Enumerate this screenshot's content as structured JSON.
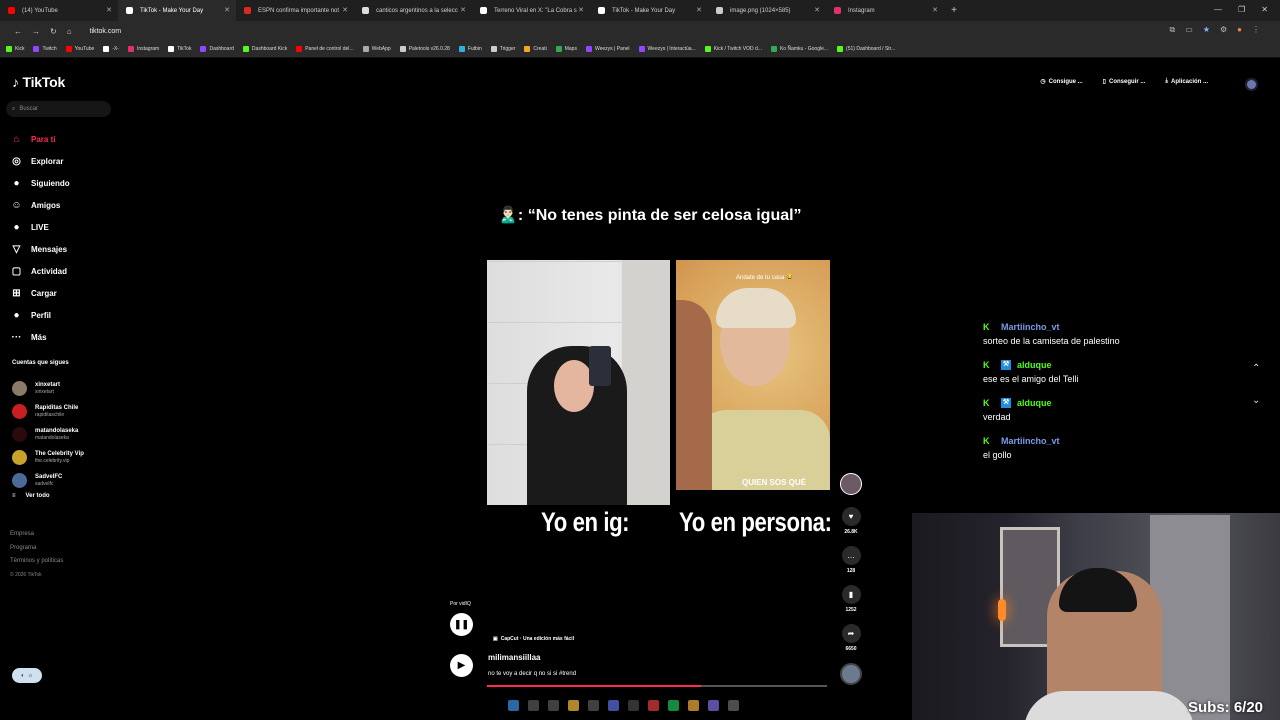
{
  "browser": {
    "tabs": [
      {
        "title": "(14) YouTube",
        "color": "#ff0000",
        "active": false
      },
      {
        "title": "TikTok - Make Your Day",
        "color": "#ffffff",
        "active": true
      },
      {
        "title": "ESPN confirma importante not",
        "color": "#e0281e",
        "active": false
      },
      {
        "title": "canticos argentinos a la selecc",
        "color": "#dddddd",
        "active": false
      },
      {
        "title": "Terreno Viral en X: \"La Cobra s",
        "color": "#ffffff",
        "active": false
      },
      {
        "title": "TikTok - Make Your Day",
        "color": "#ffffff",
        "active": false
      },
      {
        "title": "image.png (1024×585)",
        "color": "#cccccc",
        "active": false
      },
      {
        "title": "Instagram",
        "color": "#e1306c",
        "active": false
      }
    ],
    "new_tab": "+",
    "url": "tiktok.com",
    "bookmarks": [
      {
        "label": "Kick",
        "color": "#53fc18"
      },
      {
        "label": "Twitch",
        "color": "#9146ff"
      },
      {
        "label": "YouTube",
        "color": "#ff0000"
      },
      {
        "label": "-X-",
        "color": "#ffffff"
      },
      {
        "label": "Instagram",
        "color": "#e1306c"
      },
      {
        "label": "TikTok",
        "color": "#ffffff"
      },
      {
        "label": "Dashboard",
        "color": "#9146ff"
      },
      {
        "label": "Dashboard Kick",
        "color": "#53fc18"
      },
      {
        "label": "Panel de control del...",
        "color": "#ff0000"
      },
      {
        "label": "WebApp",
        "color": "#aaaaaa"
      },
      {
        "label": "Paletools v26.0.28",
        "color": "#cccccc"
      },
      {
        "label": "Futbin",
        "color": "#2fb1e0"
      },
      {
        "label": "Trigger",
        "color": "#cccccc"
      },
      {
        "label": "Creati",
        "color": "#f5a623"
      },
      {
        "label": "Maps",
        "color": "#34a853"
      },
      {
        "label": "Weezys | Panel",
        "color": "#9146ff"
      },
      {
        "label": "Weezys | Interactúa...",
        "color": "#9146ff"
      },
      {
        "label": "Kick / Twitch VOD d...",
        "color": "#53fc18"
      },
      {
        "label": "Ko Ñamku - Google...",
        "color": "#34a853"
      },
      {
        "label": "(51) Dashboard / Str...",
        "color": "#53fc18"
      }
    ]
  },
  "tiktok": {
    "logo": "TikTok",
    "search_placeholder": "Buscar",
    "menu": [
      {
        "label": "Para ti",
        "icon": "home-icon",
        "glyph": "⌂"
      },
      {
        "label": "Explorar",
        "icon": "compass-icon",
        "glyph": "◎"
      },
      {
        "label": "Siguiendo",
        "icon": "following-icon",
        "glyph": "●"
      },
      {
        "label": "Amigos",
        "icon": "friends-icon",
        "glyph": "☺"
      },
      {
        "label": "LIVE",
        "icon": "live-icon",
        "glyph": "●"
      },
      {
        "label": "Mensajes",
        "icon": "messages-icon",
        "glyph": "▽"
      },
      {
        "label": "Actividad",
        "icon": "activity-icon",
        "glyph": "▢"
      },
      {
        "label": "Cargar",
        "icon": "upload-icon",
        "glyph": "⊞"
      },
      {
        "label": "Perfil",
        "icon": "profile-icon",
        "glyph": "●"
      },
      {
        "label": "Más",
        "icon": "more-icon",
        "glyph": "···"
      }
    ],
    "following_title": "Cuentas que sigues",
    "following": [
      {
        "name": "xinxetart",
        "handle": "xinxetart",
        "color": "#8a7a6a"
      },
      {
        "name": "Rapiditas Chile",
        "handle": "rapiditaschile",
        "color": "#c82020"
      },
      {
        "name": "matandolaseka",
        "handle": "matandolaseka",
        "color": "#2a0a0a"
      },
      {
        "name": "The Celebrity Vip",
        "handle": "the.celebrity.vip",
        "color": "#c8a22a"
      },
      {
        "name": "SadvelFC",
        "handle": "sadvelfc",
        "color": "#4a6a9a"
      }
    ],
    "see_all": "Ver todo",
    "footer": [
      "Empresa",
      "Programa",
      "Términos y políticas"
    ],
    "copyright": "© 2026 TikTok",
    "top_buttons": [
      "Consigue ...",
      "Conseguir ...",
      "Aplicación ..."
    ]
  },
  "video": {
    "caption": "🙎🏻‍♂️: “No tenes pinta de ser celosa igual”",
    "overlay_top": "Andate de tu casa 😂",
    "overlay_bottom": "QUIEN SOS QUÉ",
    "label_left": "Yo en ig:",
    "label_right": "Yo en persona:",
    "by": "Por vidIQ",
    "capcut": "CapCut · Una edición más fácil",
    "username": "milimansiillaa",
    "description": "no te voy a decir q no si si #trend",
    "progress": 0.63,
    "likes": "26.8K",
    "comments": "128",
    "saves": "1252",
    "shares": "6650"
  },
  "chat": [
    {
      "user": "Martiincho_vt",
      "mod": false,
      "color": "#7a9be8",
      "text": "sorteo de la camiseta de palestino"
    },
    {
      "user": "alduque",
      "mod": true,
      "color": "#53fc18",
      "text": "ese es el amigo del Telli"
    },
    {
      "user": "alduque",
      "mod": true,
      "color": "#53fc18",
      "text": "verdad"
    },
    {
      "user": "Martiincho_vt",
      "mod": false,
      "color": "#7a9be8",
      "text": "el gollo"
    }
  ],
  "stream": {
    "subs": "Subs: 6/20"
  }
}
